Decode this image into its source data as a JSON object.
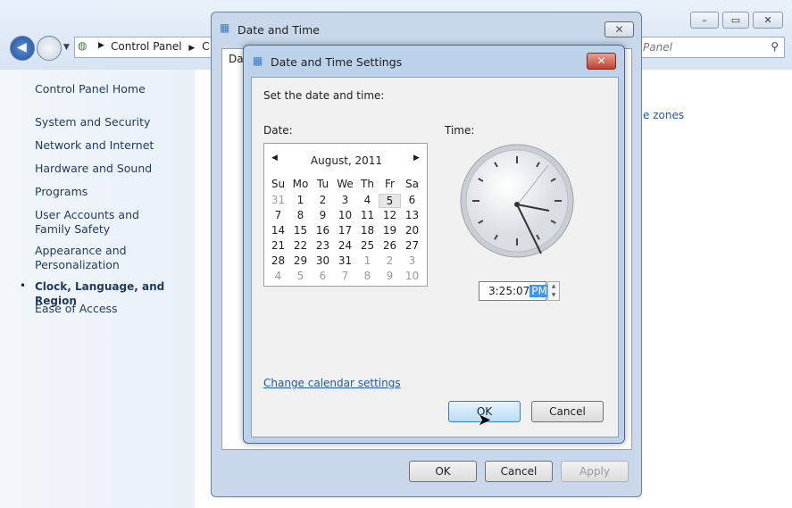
{
  "control_panel": {
    "breadcrumb": [
      "Control Panel",
      "C"
    ],
    "search_placeholder": "Panel",
    "window_buttons": [
      "–",
      "▭",
      "✕"
    ],
    "sidebar": [
      {
        "label": "Control Panel Home"
      },
      {
        "label": "System and Security"
      },
      {
        "label": "Network and Internet"
      },
      {
        "label": "Hardware and Sound"
      },
      {
        "label": "Programs"
      },
      {
        "label": "User Accounts and Family Safety"
      },
      {
        "label": "Appearance and Personalization"
      },
      {
        "label": "Clock, Language, and Region",
        "active": true
      },
      {
        "label": "Ease of Access"
      }
    ],
    "content_link": "e zones"
  },
  "date_time": {
    "title": "Date and Time",
    "tab_partial": "Da",
    "ok": "OK",
    "cancel": "Cancel",
    "apply": "Apply"
  },
  "settings": {
    "title": "Date and Time Settings",
    "prompt": "Set the date and time:",
    "date_label": "Date:",
    "time_label": "Time:",
    "month": "August, 2011",
    "weekdays": [
      "Su",
      "Mo",
      "Tu",
      "We",
      "Th",
      "Fr",
      "Sa"
    ],
    "weeks": [
      [
        "31",
        "1",
        "2",
        "3",
        "4",
        "5",
        "6"
      ],
      [
        "7",
        "8",
        "9",
        "10",
        "11",
        "12",
        "13"
      ],
      [
        "14",
        "15",
        "16",
        "17",
        "18",
        "19",
        "20"
      ],
      [
        "21",
        "22",
        "23",
        "24",
        "25",
        "26",
        "27"
      ],
      [
        "28",
        "29",
        "30",
        "31",
        "1",
        "2",
        "3"
      ],
      [
        "4",
        "5",
        "6",
        "7",
        "8",
        "9",
        "10"
      ]
    ],
    "selected_day": "5",
    "time": "3:25:07",
    "ampm": "PM",
    "change_calendar": "Change calendar settings",
    "ok": "OK",
    "cancel": "Cancel"
  }
}
